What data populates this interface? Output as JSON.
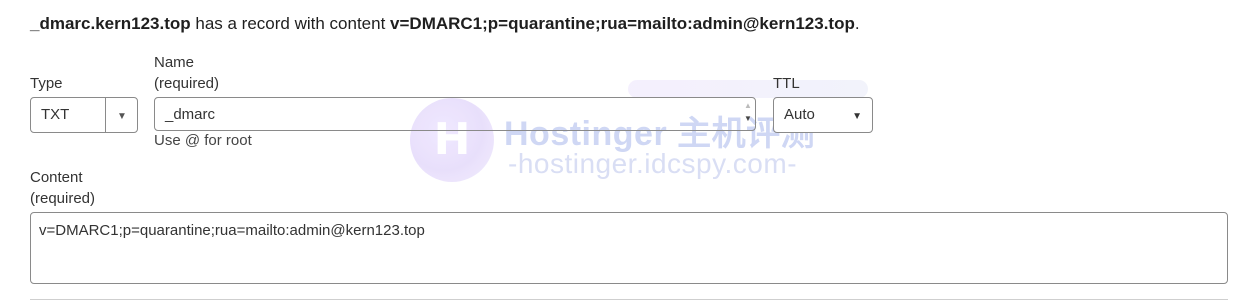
{
  "summary": {
    "record_name": "_dmarc.kern123.top",
    "middle_text": " has a record with content ",
    "record_content": "v=DMARC1;p=quarantine;rua=mailto:admin@kern123.top",
    "end_punct": "."
  },
  "type_field": {
    "label": "Type",
    "value": "TXT",
    "arrow": "▼"
  },
  "name_field": {
    "label": "Name",
    "required": "(required)",
    "value": "_dmarc",
    "hint": "Use @ for root",
    "spin_up": "▲",
    "spin_down": "▼"
  },
  "ttl_field": {
    "label": "TTL",
    "value": "Auto",
    "arrow": "▼"
  },
  "content_field": {
    "label": "Content",
    "required": "(required)",
    "value": "v=DMARC1;p=quarantine;rua=mailto:admin@kern123.top"
  },
  "watermark": {
    "logo_letter": "H",
    "title": "Hostinger 主机评测",
    "subtitle": "-hostinger.idcspy.com-"
  }
}
